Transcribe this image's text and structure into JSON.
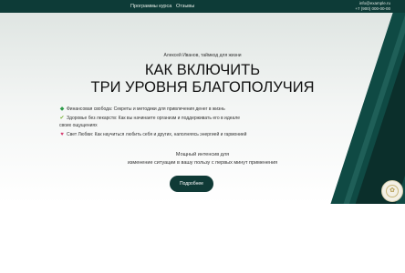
{
  "topbar": {
    "nav": [
      {
        "label": "Программы курса"
      },
      {
        "label": "Отзывы"
      }
    ],
    "contacts": {
      "line1": "info@example.ru",
      "line2": "+7 (900) 000-00-00"
    }
  },
  "hero": {
    "eyebrow": "Алексей Иванов, таймкод для жизни",
    "title_line1": "КАК ВКЛЮЧИТЬ",
    "title_line2": "ТРИ УРОВНЯ БЛАГОПОЛУЧИЯ",
    "features": [
      {
        "icon": "diamond-icon",
        "glyph": "◆",
        "color": "#2e9c4a",
        "text": "Финансовая свобода: Секреты и методики для привлечения денег в жизнь"
      },
      {
        "icon": "check-icon",
        "glyph": "✔",
        "color": "#7bb33a",
        "text": "Здоровье без лекарств: Как вы начинаете организм и поддерживать его в идеале"
      },
      {
        "icon": "heart-icon",
        "glyph": "♥",
        "color": "#d63a6f",
        "text": "Свет Любви: Как научиться любить себя и других, наполняясь энергией и гармонией"
      }
    ],
    "feature2_continuation": "своих ощущениях",
    "subtitle1": "Мощный интенсив для",
    "subtitle2": "изменение ситуации в вашу пользу с первых минут применения",
    "cta_label": "Подробнее"
  },
  "colors": {
    "dark_green": "#0f3a36",
    "accent_green": "#2e9c4a",
    "heart": "#d63a6f"
  }
}
